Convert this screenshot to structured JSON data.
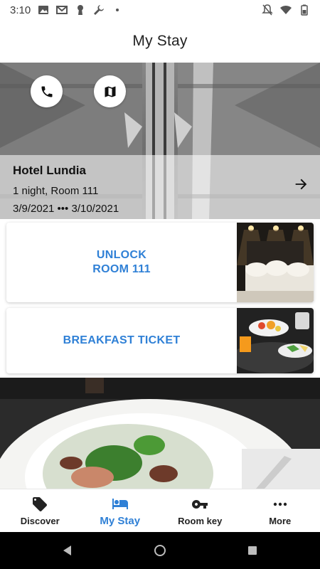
{
  "status_bar": {
    "time": "3:10",
    "left_icons": [
      "image-icon",
      "gmail-icon",
      "keyhole-icon",
      "wrench-icon",
      "dot-icon"
    ],
    "right_icons": [
      "notifications-off-icon",
      "wifi-icon",
      "battery-icon"
    ]
  },
  "header": {
    "title": "My Stay"
  },
  "hero": {
    "hotel_name": "Hotel Lundia",
    "stay_summary": "1 night, Room 111",
    "dates": "3/9/2021 ••• 3/10/2021",
    "call_icon": "phone-icon",
    "map_icon": "map-icon",
    "arrow_icon": "arrow-right-icon"
  },
  "cards": {
    "unlock": {
      "line1": "UNLOCK",
      "line2": "ROOM 111"
    },
    "breakfast": {
      "label": "BREAKFAST TICKET"
    }
  },
  "bottom_nav": {
    "items": [
      {
        "label": "Discover",
        "icon": "tag-icon",
        "active": false
      },
      {
        "label": "My Stay",
        "icon": "bed-icon",
        "active": true
      },
      {
        "label": "Room key",
        "icon": "key-icon",
        "active": false
      },
      {
        "label": "More",
        "icon": "more-dots-icon",
        "active": false
      }
    ]
  },
  "colors": {
    "accent": "#2f80d6",
    "text": "#222222",
    "nav_bar": "#000000"
  }
}
